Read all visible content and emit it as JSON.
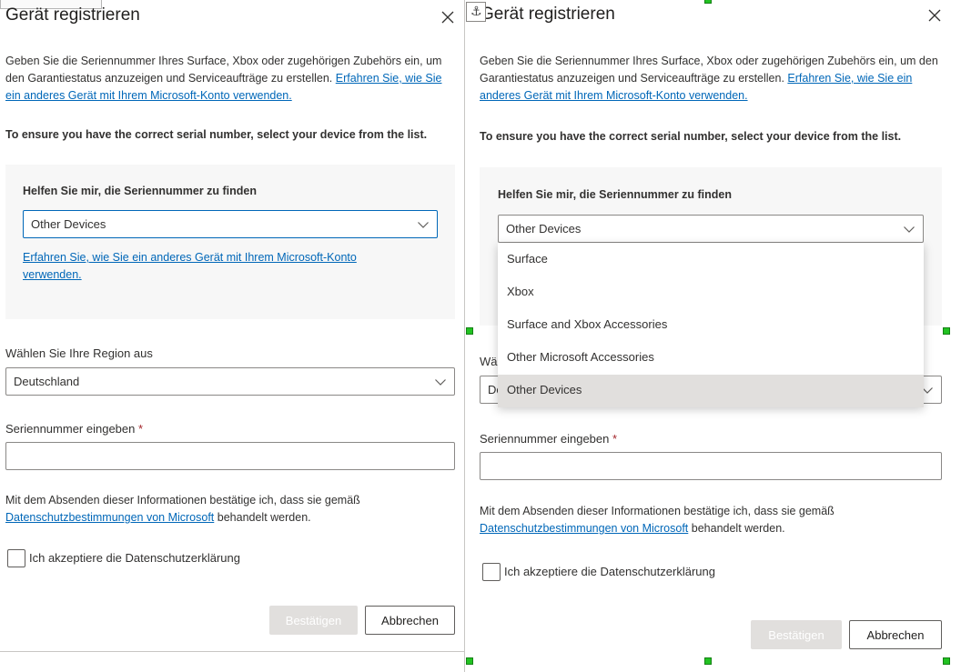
{
  "dialog": {
    "title": "Gerät registrieren",
    "description_text": "Geben Sie die Seriennummer Ihres Surface, Xbox oder zugehörigen Zubehörs ein, um den Garantiestatus anzuzeigen und Serviceaufträge zu erstellen.",
    "description_link": "Erfahren Sie, wie Sie ein anderes Gerät mit Ihrem Microsoft-Konto verwenden.",
    "serial_note": "To ensure you have the correct serial number, select your device from the list.",
    "help_title": "Helfen Sie mir, die Seriennummer zu finden",
    "device_select_value": "Other Devices",
    "help_link": "Erfahren Sie, wie Sie ein anderes Gerät mit Ihrem Microsoft-Konto verwenden.",
    "region_label": "Wählen Sie Ihre Region aus",
    "region_value": "Deutschland",
    "serial_label": "Seriennummer eingeben",
    "required_marker": "*",
    "serial_value": "",
    "privacy_text_before": "Mit dem Absenden dieser Informationen bestätige ich, dass sie gemäß",
    "privacy_link": "Datenschutzbestimmungen von Microsoft",
    "privacy_text_after": "behandelt werden.",
    "checkbox_label": "Ich akzeptiere die Datenschutzerklärung",
    "confirm_button": "Bestätigen",
    "cancel_button": "Abbrechen"
  },
  "dropdown": {
    "options": [
      "Surface",
      "Xbox",
      "Surface and Xbox Accessories",
      "Other Microsoft Accessories",
      "Other Devices"
    ],
    "selected": "Other Devices"
  },
  "region_value_truncated": "De",
  "region_label_truncated": "Wä",
  "colors": {
    "link": "#0067b8",
    "required": "#a4262c",
    "help_box_bg": "#f7f7f7",
    "disabled_button": "#e1dfdd",
    "selection_handle": "#22c222"
  },
  "icons": {
    "close": "close-icon",
    "dropdown": "chevron-down-icon",
    "anchor": "anchor-icon"
  }
}
